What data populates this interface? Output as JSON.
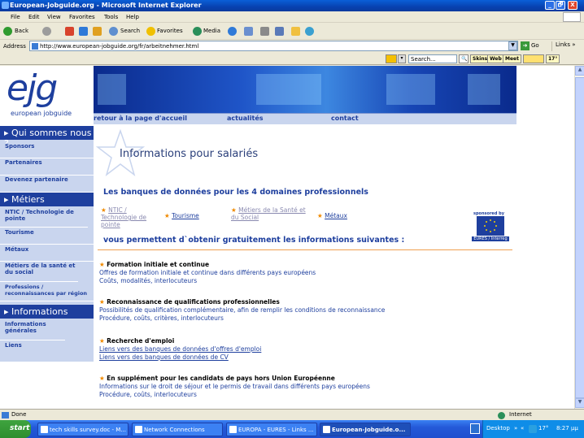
{
  "window": {
    "title": "European-Jobguide.org - Microsoft Internet Explorer",
    "min": "_",
    "max": "🗗",
    "close": "X"
  },
  "menu": [
    "File",
    "Edit",
    "View",
    "Favorites",
    "Tools",
    "Help"
  ],
  "toolbar": {
    "back": "Back",
    "search": "Search",
    "favorites": "Favorites",
    "media": "Media"
  },
  "address": {
    "label": "Address",
    "url": "http://www.european-jobguide.org/fr/arbeitnehmer.html",
    "go": "Go",
    "links": "Links"
  },
  "searchbar": {
    "placeholder": "Search...",
    "buttons": [
      "Skins",
      "Web",
      "Meet",
      "17°"
    ]
  },
  "site": {
    "logo": "ejg",
    "logo_sub": "european jobguide",
    "nav": [
      "retour à la page d'accueil",
      "actualités",
      "contact"
    ],
    "sidebar": {
      "h1": "Qui sommes nous ?",
      "i1": [
        "Sponsors",
        "Partenaires",
        "Devenez partenaire"
      ],
      "h2": "Métiers",
      "i2": [
        "NTIC / Technologie de pointe",
        "Tourisme",
        "Métaux",
        "Métiers de la santé et du social",
        "Professions / reconnaissances par région"
      ],
      "h3": "Informations",
      "i3": [
        "Informations générales",
        "Liens"
      ]
    },
    "title": "Informations pour salariés",
    "subtitle": "Les banques de données pour les 4 domaines professionnels",
    "domains": [
      "NTIC / Technologie de pointe",
      "Tourisme",
      "Métiers de la Santé et du Social",
      "Métaux"
    ],
    "sponsor": {
      "label": "sponsored by",
      "caption": "EURES / Interreg"
    },
    "permet": "vous permettent d`obtenir gratuitement les informations suivantes :",
    "sections": [
      {
        "h": "Formation initiale et continue",
        "l1": "Offres de formation initiale et continue dans différents pays européens",
        "l2": "Coûts, modalités, interlocuteurs"
      },
      {
        "h": "Reconnaissance de qualifications professionnelles",
        "l1": "Possibilités de qualification complémentaire, afin de remplir les conditions de reconnaissance",
        "l2": "Procédure, coûts, critères, interlocuteurs"
      },
      {
        "h": "Recherche d'emploi",
        "l1": "Liens vers des banques de données d'offres d'emploi",
        "l2": "Liens vers des banques de données de CV"
      },
      {
        "h": "En supplément pour les candidats de pays hors Union Européenne",
        "l1": "Informations sur le droit de séjour et le permis de travail dans différents pays européens",
        "l2": "Procédure, coûts, interlocuteurs"
      }
    ]
  },
  "status": {
    "text": "Done",
    "zone": "Internet"
  },
  "taskbar": {
    "start": "start",
    "tasks": [
      "tech skills survey.doc - M...",
      "Network Connections",
      "EUROPA - EURES - Links ...",
      "European-Jobguide.o..."
    ],
    "desktop": "Desktop",
    "temp": "17°",
    "clock": "8:27 μμ"
  }
}
